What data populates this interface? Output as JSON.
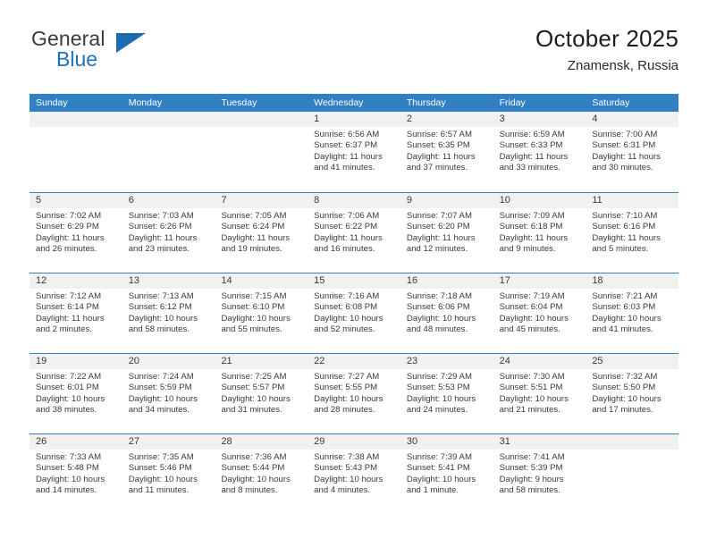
{
  "brand": {
    "name_top": "General",
    "name_bottom": "Blue",
    "accent_color": "#1b6cb0"
  },
  "header": {
    "title": "October 2025",
    "subtitle": "Znamensk, Russia"
  },
  "calendar": {
    "header_bg": "#3280c4",
    "weekday_headers": [
      "Sunday",
      "Monday",
      "Tuesday",
      "Wednesday",
      "Thursday",
      "Friday",
      "Saturday"
    ],
    "weeks": [
      [
        {
          "date": "",
          "empty": true
        },
        {
          "date": "",
          "empty": true
        },
        {
          "date": "",
          "empty": true
        },
        {
          "date": "1",
          "sunrise": "Sunrise: 6:56 AM",
          "sunset": "Sunset: 6:37 PM",
          "daylight_line1": "Daylight: 11 hours",
          "daylight_line2": "and 41 minutes."
        },
        {
          "date": "2",
          "sunrise": "Sunrise: 6:57 AM",
          "sunset": "Sunset: 6:35 PM",
          "daylight_line1": "Daylight: 11 hours",
          "daylight_line2": "and 37 minutes."
        },
        {
          "date": "3",
          "sunrise": "Sunrise: 6:59 AM",
          "sunset": "Sunset: 6:33 PM",
          "daylight_line1": "Daylight: 11 hours",
          "daylight_line2": "and 33 minutes."
        },
        {
          "date": "4",
          "sunrise": "Sunrise: 7:00 AM",
          "sunset": "Sunset: 6:31 PM",
          "daylight_line1": "Daylight: 11 hours",
          "daylight_line2": "and 30 minutes."
        }
      ],
      [
        {
          "date": "5",
          "sunrise": "Sunrise: 7:02 AM",
          "sunset": "Sunset: 6:29 PM",
          "daylight_line1": "Daylight: 11 hours",
          "daylight_line2": "and 26 minutes."
        },
        {
          "date": "6",
          "sunrise": "Sunrise: 7:03 AM",
          "sunset": "Sunset: 6:26 PM",
          "daylight_line1": "Daylight: 11 hours",
          "daylight_line2": "and 23 minutes."
        },
        {
          "date": "7",
          "sunrise": "Sunrise: 7:05 AM",
          "sunset": "Sunset: 6:24 PM",
          "daylight_line1": "Daylight: 11 hours",
          "daylight_line2": "and 19 minutes."
        },
        {
          "date": "8",
          "sunrise": "Sunrise: 7:06 AM",
          "sunset": "Sunset: 6:22 PM",
          "daylight_line1": "Daylight: 11 hours",
          "daylight_line2": "and 16 minutes."
        },
        {
          "date": "9",
          "sunrise": "Sunrise: 7:07 AM",
          "sunset": "Sunset: 6:20 PM",
          "daylight_line1": "Daylight: 11 hours",
          "daylight_line2": "and 12 minutes."
        },
        {
          "date": "10",
          "sunrise": "Sunrise: 7:09 AM",
          "sunset": "Sunset: 6:18 PM",
          "daylight_line1": "Daylight: 11 hours",
          "daylight_line2": "and 9 minutes."
        },
        {
          "date": "11",
          "sunrise": "Sunrise: 7:10 AM",
          "sunset": "Sunset: 6:16 PM",
          "daylight_line1": "Daylight: 11 hours",
          "daylight_line2": "and 5 minutes."
        }
      ],
      [
        {
          "date": "12",
          "sunrise": "Sunrise: 7:12 AM",
          "sunset": "Sunset: 6:14 PM",
          "daylight_line1": "Daylight: 11 hours",
          "daylight_line2": "and 2 minutes."
        },
        {
          "date": "13",
          "sunrise": "Sunrise: 7:13 AM",
          "sunset": "Sunset: 6:12 PM",
          "daylight_line1": "Daylight: 10 hours",
          "daylight_line2": "and 58 minutes."
        },
        {
          "date": "14",
          "sunrise": "Sunrise: 7:15 AM",
          "sunset": "Sunset: 6:10 PM",
          "daylight_line1": "Daylight: 10 hours",
          "daylight_line2": "and 55 minutes."
        },
        {
          "date": "15",
          "sunrise": "Sunrise: 7:16 AM",
          "sunset": "Sunset: 6:08 PM",
          "daylight_line1": "Daylight: 10 hours",
          "daylight_line2": "and 52 minutes."
        },
        {
          "date": "16",
          "sunrise": "Sunrise: 7:18 AM",
          "sunset": "Sunset: 6:06 PM",
          "daylight_line1": "Daylight: 10 hours",
          "daylight_line2": "and 48 minutes."
        },
        {
          "date": "17",
          "sunrise": "Sunrise: 7:19 AM",
          "sunset": "Sunset: 6:04 PM",
          "daylight_line1": "Daylight: 10 hours",
          "daylight_line2": "and 45 minutes."
        },
        {
          "date": "18",
          "sunrise": "Sunrise: 7:21 AM",
          "sunset": "Sunset: 6:03 PM",
          "daylight_line1": "Daylight: 10 hours",
          "daylight_line2": "and 41 minutes."
        }
      ],
      [
        {
          "date": "19",
          "sunrise": "Sunrise: 7:22 AM",
          "sunset": "Sunset: 6:01 PM",
          "daylight_line1": "Daylight: 10 hours",
          "daylight_line2": "and 38 minutes."
        },
        {
          "date": "20",
          "sunrise": "Sunrise: 7:24 AM",
          "sunset": "Sunset: 5:59 PM",
          "daylight_line1": "Daylight: 10 hours",
          "daylight_line2": "and 34 minutes."
        },
        {
          "date": "21",
          "sunrise": "Sunrise: 7:25 AM",
          "sunset": "Sunset: 5:57 PM",
          "daylight_line1": "Daylight: 10 hours",
          "daylight_line2": "and 31 minutes."
        },
        {
          "date": "22",
          "sunrise": "Sunrise: 7:27 AM",
          "sunset": "Sunset: 5:55 PM",
          "daylight_line1": "Daylight: 10 hours",
          "daylight_line2": "and 28 minutes."
        },
        {
          "date": "23",
          "sunrise": "Sunrise: 7:29 AM",
          "sunset": "Sunset: 5:53 PM",
          "daylight_line1": "Daylight: 10 hours",
          "daylight_line2": "and 24 minutes."
        },
        {
          "date": "24",
          "sunrise": "Sunrise: 7:30 AM",
          "sunset": "Sunset: 5:51 PM",
          "daylight_line1": "Daylight: 10 hours",
          "daylight_line2": "and 21 minutes."
        },
        {
          "date": "25",
          "sunrise": "Sunrise: 7:32 AM",
          "sunset": "Sunset: 5:50 PM",
          "daylight_line1": "Daylight: 10 hours",
          "daylight_line2": "and 17 minutes."
        }
      ],
      [
        {
          "date": "26",
          "sunrise": "Sunrise: 7:33 AM",
          "sunset": "Sunset: 5:48 PM",
          "daylight_line1": "Daylight: 10 hours",
          "daylight_line2": "and 14 minutes."
        },
        {
          "date": "27",
          "sunrise": "Sunrise: 7:35 AM",
          "sunset": "Sunset: 5:46 PM",
          "daylight_line1": "Daylight: 10 hours",
          "daylight_line2": "and 11 minutes."
        },
        {
          "date": "28",
          "sunrise": "Sunrise: 7:36 AM",
          "sunset": "Sunset: 5:44 PM",
          "daylight_line1": "Daylight: 10 hours",
          "daylight_line2": "and 8 minutes."
        },
        {
          "date": "29",
          "sunrise": "Sunrise: 7:38 AM",
          "sunset": "Sunset: 5:43 PM",
          "daylight_line1": "Daylight: 10 hours",
          "daylight_line2": "and 4 minutes."
        },
        {
          "date": "30",
          "sunrise": "Sunrise: 7:39 AM",
          "sunset": "Sunset: 5:41 PM",
          "daylight_line1": "Daylight: 10 hours",
          "daylight_line2": "and 1 minute."
        },
        {
          "date": "31",
          "sunrise": "Sunrise: 7:41 AM",
          "sunset": "Sunset: 5:39 PM",
          "daylight_line1": "Daylight: 9 hours",
          "daylight_line2": "and 58 minutes."
        },
        {
          "date": "",
          "empty": true
        }
      ]
    ]
  }
}
